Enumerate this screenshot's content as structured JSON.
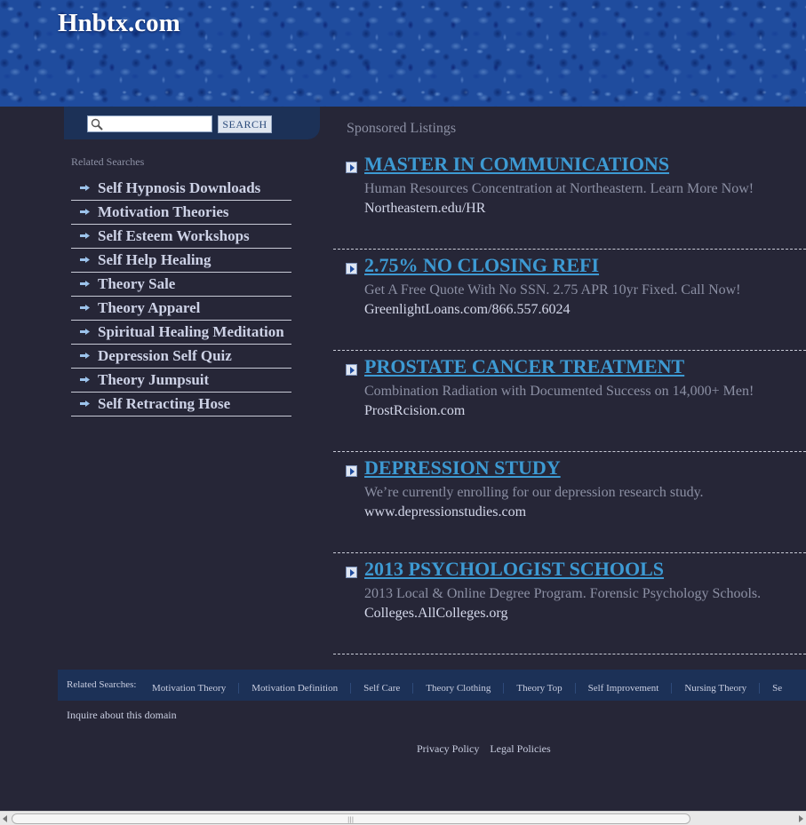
{
  "header": {
    "site_title": "Hnbtx.com"
  },
  "search": {
    "placeholder": "",
    "value": "",
    "button_label": "SEARCH"
  },
  "sidebar": {
    "label": "Related Searches",
    "items": [
      "Self Hypnosis Downloads",
      "Motivation Theories",
      "Self Esteem Workshops",
      "Self Help Healing",
      "Theory Sale",
      "Theory Apparel",
      "Spiritual Healing Meditation",
      "Depression Self Quiz",
      "Theory Jumpsuit",
      "Self Retracting Hose"
    ]
  },
  "sponsored": {
    "title": "Sponsored Listings",
    "ads": [
      {
        "title": "MASTER IN COMMUNICATIONS",
        "description": "Human Resources Concentration at Northeastern. Learn More Now!",
        "url": "Northeastern.edu/HR"
      },
      {
        "title": "2.75% NO CLOSING REFI",
        "description": "Get A Free Quote With No SSN. 2.75 APR 10yr Fixed. Call Now!",
        "url": "GreenlightLoans.com/866.557.6024"
      },
      {
        "title": "PROSTATE CANCER TREATMENT",
        "description": "Combination Radiation with Documented Success on 14,000+ Men!",
        "url": "ProstRcision.com"
      },
      {
        "title": "DEPRESSION STUDY",
        "description": "We’re currently enrolling for our depression research study.",
        "url": "www.depressionstudies.com"
      },
      {
        "title": "2013 PSYCHOLOGIST SCHOOLS",
        "description": "2013 Local & Online Degree Program. Forensic Psychology Schools.",
        "url": "Colleges.AllColleges.org"
      }
    ]
  },
  "footer": {
    "related_label": "Related Searches:",
    "related_links": [
      "Motivation Theory",
      "Motivation Definition",
      "Self Care",
      "Theory Clothing",
      "Theory Top",
      "Self Improvement",
      "Nursing Theory",
      "Se"
    ],
    "inquire": "Inquire about this domain",
    "privacy": "Privacy Policy",
    "legal": "Legal Policies"
  },
  "icons": {
    "search": "magnifier-icon",
    "bullet": "arrow-bullet-icon",
    "ad": "arrow-box-icon"
  },
  "colors": {
    "background": "#262637",
    "link": "#3d9ad3",
    "panel": "#1c3157"
  }
}
